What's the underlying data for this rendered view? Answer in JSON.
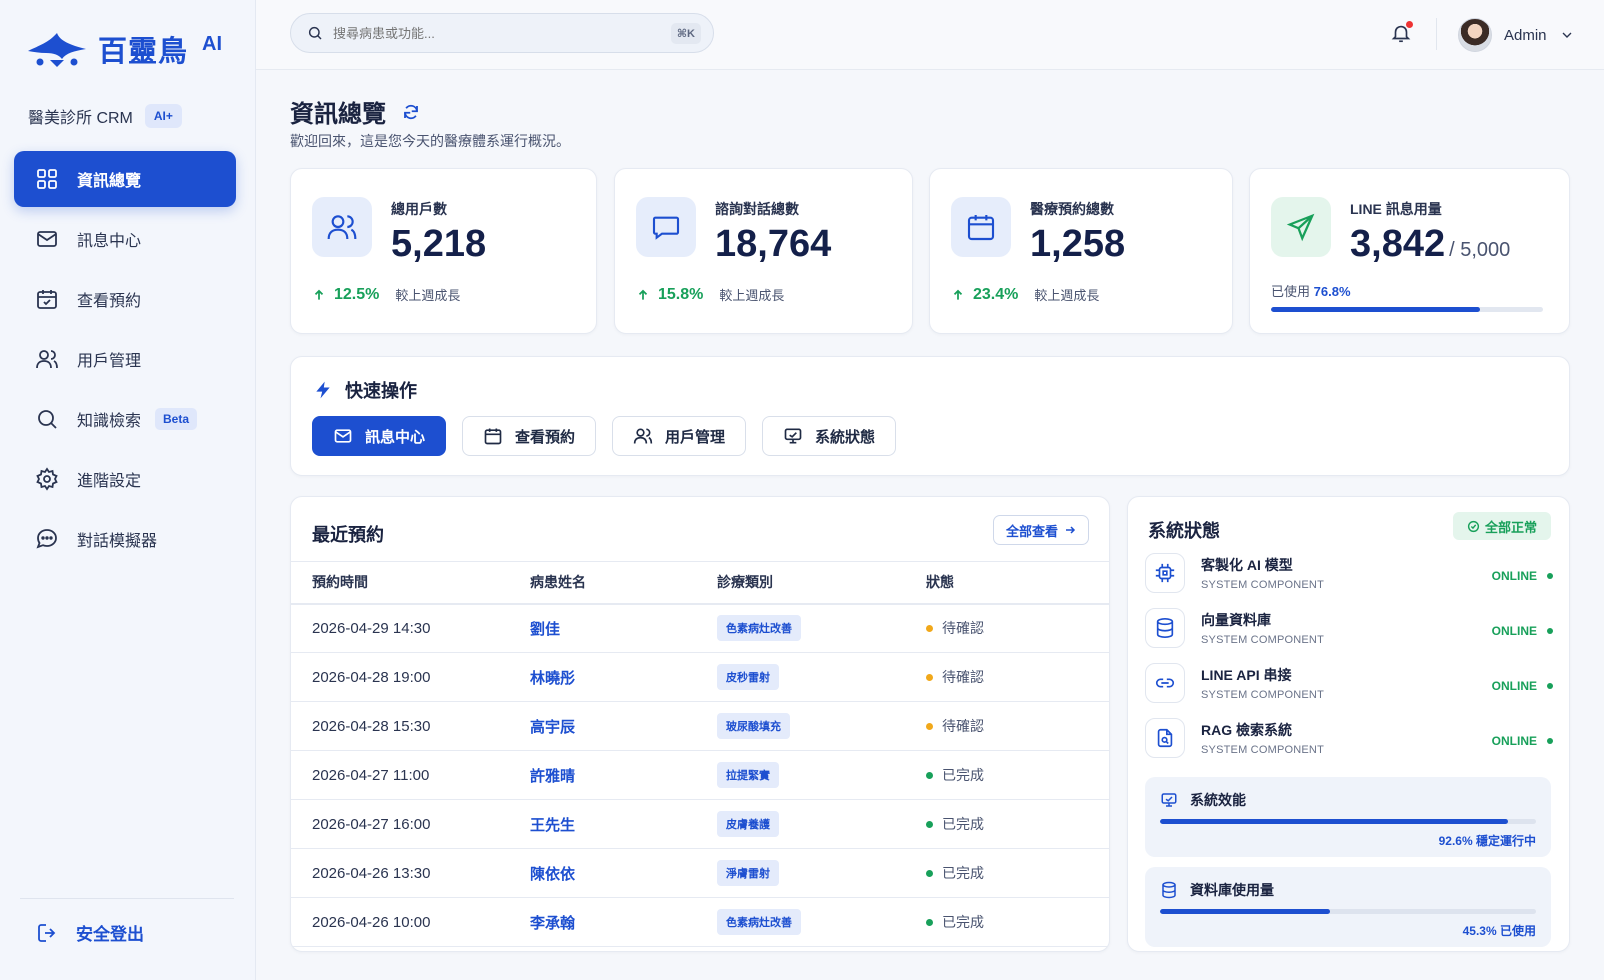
{
  "brand": {
    "name": "百靈鳥",
    "suffix": "AI",
    "accent": "#1d4fd0"
  },
  "clinic": {
    "name": "醫美診所 CRM",
    "badge": "AI+"
  },
  "sidebar": {
    "items": [
      {
        "label": "資訊總覽",
        "icon": "grid-icon",
        "active": true
      },
      {
        "label": "訊息中心",
        "icon": "mail-icon"
      },
      {
        "label": "查看預約",
        "icon": "calendar-check-icon"
      },
      {
        "label": "用戶管理",
        "icon": "users-icon"
      },
      {
        "label": "知識檢索",
        "icon": "search-icon",
        "badge": "Beta"
      },
      {
        "label": "進階設定",
        "icon": "gear-icon"
      },
      {
        "label": "對話模擬器",
        "icon": "chat-dots-icon"
      }
    ],
    "logout": "安全登出"
  },
  "header": {
    "search_placeholder": "搜尋病患或功能...",
    "shortcut": "⌘K",
    "user": "Admin"
  },
  "page": {
    "title": "資訊總覽",
    "subtitle": "歡迎回來，這是您今天的醫療體系運行概況。"
  },
  "stats": [
    {
      "label": "總用戶數",
      "value": "5,218",
      "trend": "12.5%",
      "trend_label": "較上週成長",
      "icon": "users-icon"
    },
    {
      "label": "諮詢對話總數",
      "value": "18,764",
      "trend": "15.8%",
      "trend_label": "較上週成長",
      "icon": "message-square-icon"
    },
    {
      "label": "醫療預約總數",
      "value": "1,258",
      "trend": "23.4%",
      "trend_label": "較上週成長",
      "icon": "calendar-icon"
    },
    {
      "label": "LINE 訊息用量",
      "value": "3,842",
      "total": "/ 5,000",
      "usage_label": "已使用",
      "usage_pct": "76.8%",
      "usage_fraction": 0.768,
      "icon": "send-icon"
    }
  ],
  "quick_actions": {
    "title": "快速操作",
    "buttons": [
      {
        "label": "訊息中心",
        "icon": "mail-icon",
        "primary": true
      },
      {
        "label": "查看預約",
        "icon": "calendar-icon"
      },
      {
        "label": "用戶管理",
        "icon": "users-icon"
      },
      {
        "label": "系統狀態",
        "icon": "monitor-icon"
      }
    ]
  },
  "appointments": {
    "title": "最近預約",
    "view_all": "全部查看",
    "columns": [
      "預約時間",
      "病患姓名",
      "診療類別",
      "狀態"
    ],
    "rows": [
      {
        "time": "2026-04-29 14:30",
        "patient": "劉佳",
        "category": "色素病灶改善",
        "status": "待確認",
        "state": "pending"
      },
      {
        "time": "2026-04-28 19:00",
        "patient": "林曉彤",
        "category": "皮秒雷射",
        "status": "待確認",
        "state": "pending"
      },
      {
        "time": "2026-04-28 15:30",
        "patient": "高宇辰",
        "category": "玻尿酸填充",
        "status": "待確認",
        "state": "pending"
      },
      {
        "time": "2026-04-27 11:00",
        "patient": "許雅晴",
        "category": "拉提緊實",
        "status": "已完成",
        "state": "done"
      },
      {
        "time": "2026-04-27 16:00",
        "patient": "王先生",
        "category": "皮膚養護",
        "status": "已完成",
        "state": "done"
      },
      {
        "time": "2026-04-26 13:30",
        "patient": "陳依依",
        "category": "淨膚雷射",
        "status": "已完成",
        "state": "done"
      },
      {
        "time": "2026-04-26 10:00",
        "patient": "李承翰",
        "category": "色素病灶改善",
        "status": "已完成",
        "state": "done"
      }
    ]
  },
  "system": {
    "title": "系統狀態",
    "all_ok": "全部正常",
    "components": [
      {
        "name": "客製化 AI 模型",
        "sub": "SYSTEM COMPONENT",
        "state": "ONLINE",
        "icon": "cpu-icon"
      },
      {
        "name": "向量資料庫",
        "sub": "SYSTEM COMPONENT",
        "state": "ONLINE",
        "icon": "database-icon"
      },
      {
        "name": "LINE API 串接",
        "sub": "SYSTEM COMPONENT",
        "state": "ONLINE",
        "icon": "link-icon"
      },
      {
        "name": "RAG 檢索系統",
        "sub": "SYSTEM COMPONENT",
        "state": "ONLINE",
        "icon": "file-search-icon"
      }
    ],
    "metrics": [
      {
        "title": "系統效能",
        "note": "92.6% 穩定運行中",
        "fraction": 0.926,
        "icon": "monitor-icon"
      },
      {
        "title": "資料庫使用量",
        "note": "45.3% 已使用",
        "fraction": 0.453,
        "icon": "database-icon"
      }
    ]
  }
}
